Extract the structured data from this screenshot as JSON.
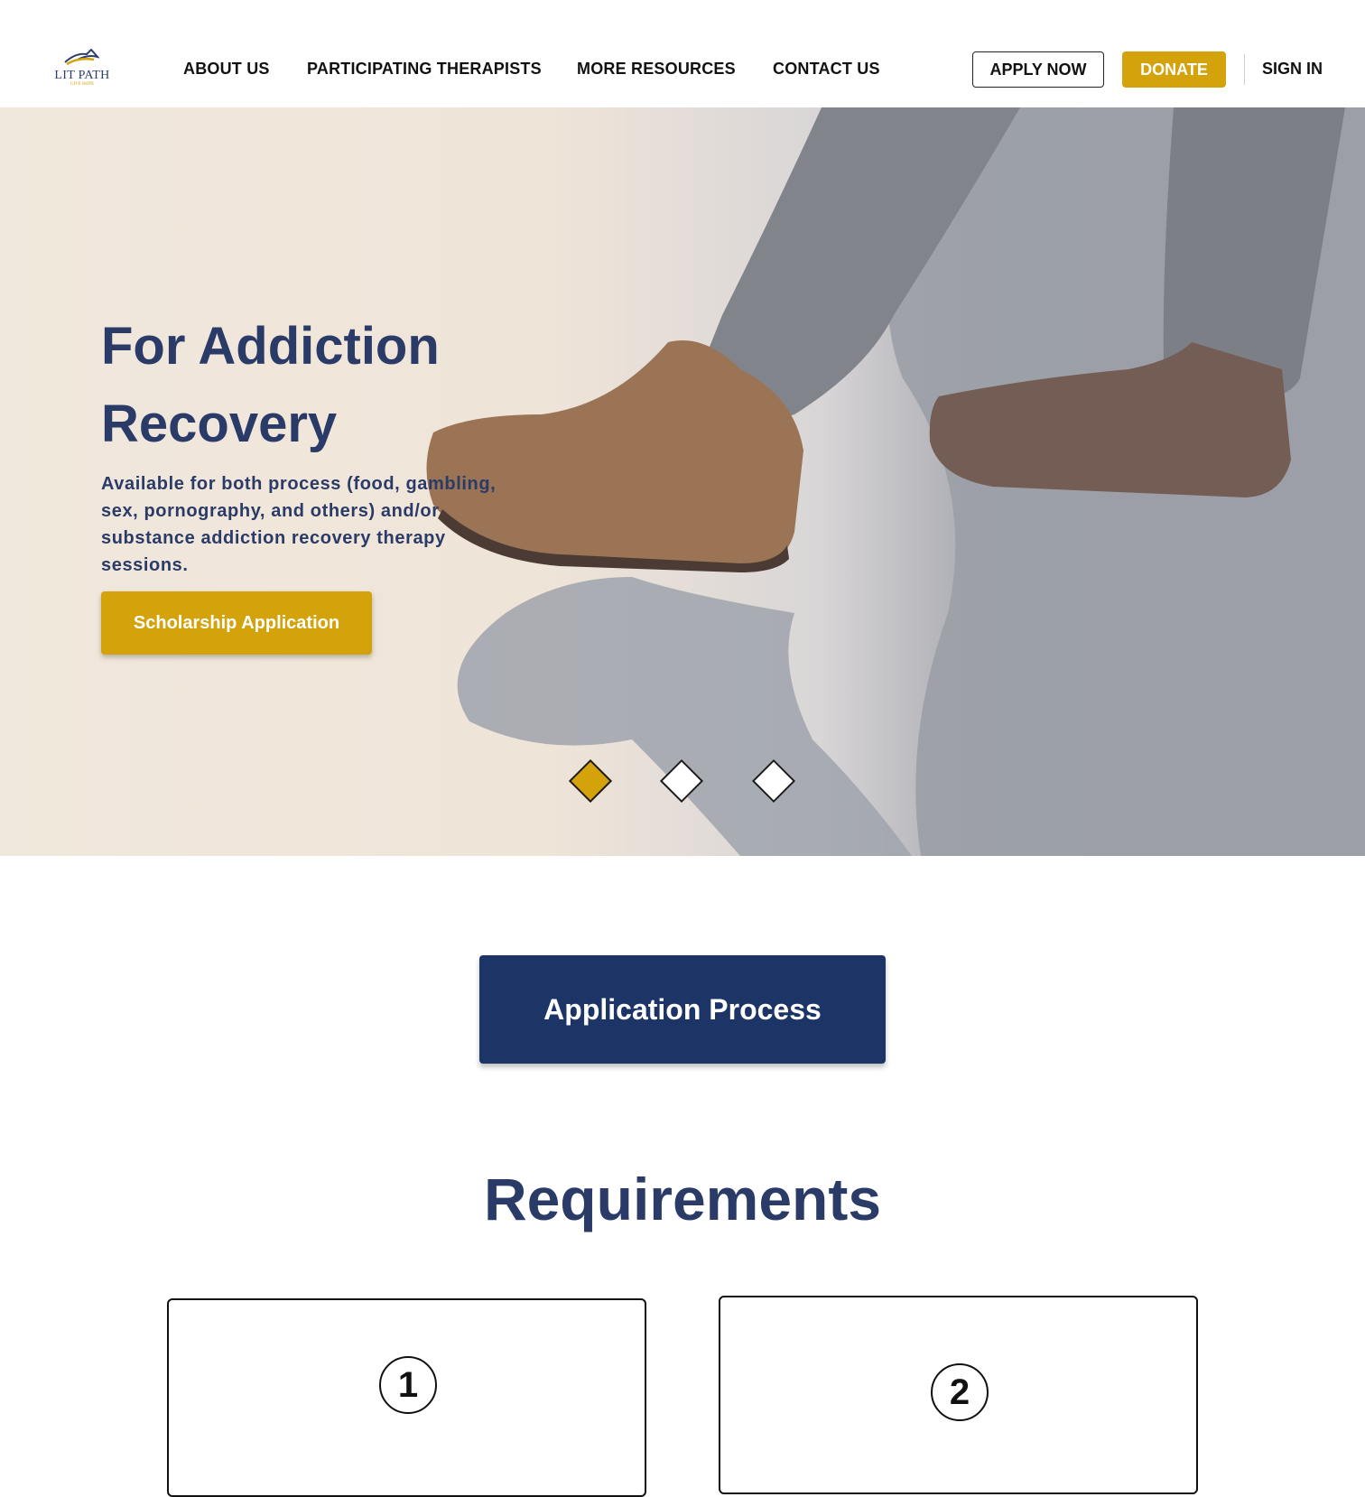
{
  "brand": {
    "name": "LIT PATH",
    "tagline": "GIVE HOPE",
    "accent": "#d4a20a",
    "navy": "#1c3566"
  },
  "nav": {
    "links": [
      "ABOUT US",
      "PARTICIPATING THERAPISTS",
      "MORE RESOURCES",
      "CONTACT US"
    ],
    "apply_label": "APPLY NOW",
    "donate_label": "DONATE",
    "signin_label": "SIGN IN"
  },
  "hero": {
    "title": "For Addiction Recovery",
    "subtitle": "Available for both process (food, gambling, sex, pornography, and others) and/or substance addiction recovery therapy sessions.",
    "cta_label": "Scholarship Application",
    "slides": {
      "count": 3,
      "active_index": 1
    }
  },
  "process": {
    "button_label": "Application Process"
  },
  "requirements": {
    "title": "Requirements",
    "cards": [
      {
        "number": "1"
      },
      {
        "number": "2"
      }
    ]
  }
}
